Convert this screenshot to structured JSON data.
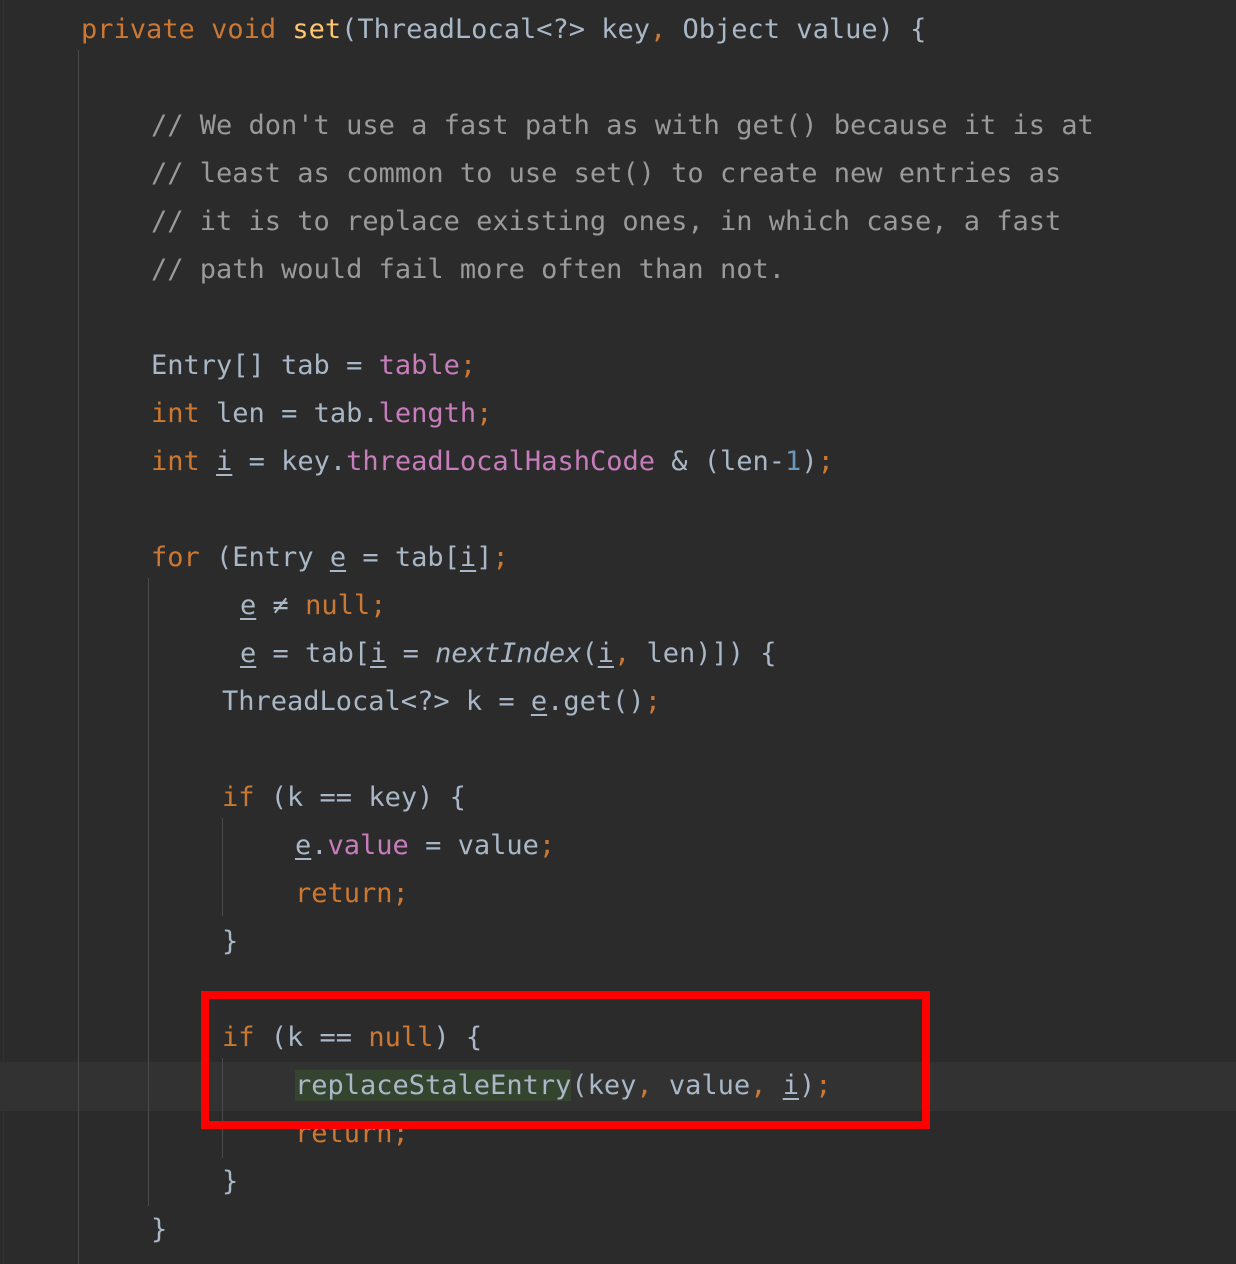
{
  "editor": {
    "background_color": "#2b2b2b",
    "current_line_color": "#323232",
    "indent_guide_color": "#4a4a4a",
    "default_text_color": "#a9b7c6",
    "keyword_color": "#cc7832",
    "method_color": "#ffc66d",
    "field_color": "#c77dbb",
    "number_color": "#6897bb",
    "comment_color": "#9a9a9a",
    "occurrence_highlight_color": "#35442f",
    "annotation_color": "#ff0000",
    "language": "java"
  },
  "code": {
    "line_01": {
      "t1": "private",
      "t2": " ",
      "t3": "void",
      "t4": " ",
      "t5": "set",
      "t6": "(ThreadLocal<?> key",
      "t7": ",",
      "t8": " Object value) {"
    },
    "line_03": {
      "text": "// We don't use a fast path as with get() because it is at"
    },
    "line_04": {
      "text": "// least as common to use set() to create new entries as"
    },
    "line_05": {
      "text": "// it is to replace existing ones, in which case, a fast"
    },
    "line_06": {
      "text": "// path would fail more often than not."
    },
    "line_08": {
      "t1": "Entry[] tab ",
      "t2": "=",
      "t3": " ",
      "t4": "table",
      "t5": ";"
    },
    "line_09": {
      "t1": "int",
      "t2": " len ",
      "t3": "=",
      "t4": " tab.",
      "t5": "length",
      "t6": ";"
    },
    "line_10": {
      "t1": "int",
      "t2": " ",
      "t3": "i",
      "t4": " ",
      "t5": "=",
      "t6": " key.",
      "t7": "threadLocalHashCode",
      "t8": " & (len",
      "t9": "-",
      "t10": "1",
      "t11": ")",
      "t12": ";"
    },
    "line_12": {
      "t1": "for",
      "t2": " (Entry ",
      "t3": "e",
      "t4": " ",
      "t5": "=",
      "t6": " tab[",
      "t7": "i",
      "t8": "]",
      "t9": ";"
    },
    "line_13": {
      "t1": "e",
      "t2": " ",
      "t3": "≠",
      "t4": " ",
      "t5": "null",
      "t6": ";"
    },
    "line_14": {
      "t1": "e",
      "t2": " ",
      "t3": "=",
      "t4": " tab[",
      "t5": "i",
      "t6": " ",
      "t7": "=",
      "t8": " ",
      "t9": "nextIndex",
      "t10": "(",
      "t11": "i",
      "t12": ",",
      "t13": " len)]) {"
    },
    "line_15": {
      "t1": "ThreadLocal<?> k ",
      "t2": "=",
      "t3": " ",
      "t4": "e",
      "t5": ".get()",
      "t6": ";"
    },
    "line_17": {
      "t1": "if",
      "t2": " (k ",
      "t3": "==",
      "t4": " key) {"
    },
    "line_18": {
      "t1": "e",
      "t2": ".",
      "t3": "value",
      "t4": " ",
      "t5": "=",
      "t6": " value",
      "t7": ";"
    },
    "line_19": {
      "t1": "return",
      "t2": ";"
    },
    "line_20": {
      "text": "}"
    },
    "line_22": {
      "t1": "if",
      "t2": " (k ",
      "t3": "==",
      "t4": " ",
      "t5": "null",
      "t6": ") {"
    },
    "line_23": {
      "t1": "replaceStaleEntry",
      "t2": "(key",
      "t3": ",",
      "t4": " value",
      "t5": ",",
      "t6": " ",
      "t7": "i",
      "t8": ")",
      "t9": ";"
    },
    "line_24": {
      "t1": "return",
      "t2": ";"
    },
    "line_25": {
      "text": "}"
    },
    "line_26": {
      "text": "}"
    }
  },
  "annotation": {
    "label": "red-highlight-rectangle",
    "covers": "if (k == null) { replaceStaleEntry(key, value, i);"
  }
}
